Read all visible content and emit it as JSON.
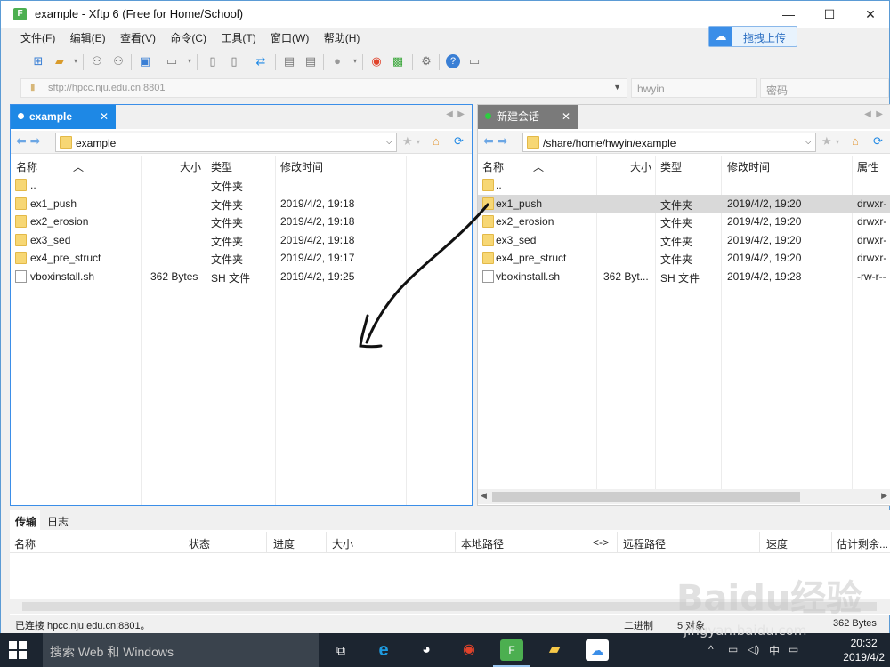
{
  "window": {
    "title": "example - Xftp 6 (Free for Home/School)",
    "minimize": "—",
    "maximize": "☐",
    "close": "✕"
  },
  "menu": [
    "文件(F)",
    "编辑(E)",
    "查看(V)",
    "命令(C)",
    "工具(T)",
    "窗口(W)",
    "帮助(H)"
  ],
  "upload_button": "拖拽上传",
  "address": {
    "url_placeholder": "sftp://hpcc.nju.edu.cn:8801",
    "user_placeholder": "hwyin",
    "password_placeholder": "密码"
  },
  "left_pane": {
    "tab_label": "example",
    "path": "example",
    "columns": [
      "名称",
      "大小",
      "类型",
      "修改时间"
    ],
    "rows": [
      {
        "name": "..",
        "size": "",
        "type": "文件夹",
        "modified": "",
        "kind": "folder"
      },
      {
        "name": "ex1_push",
        "size": "",
        "type": "文件夹",
        "modified": "2019/4/2, 19:18",
        "kind": "folder"
      },
      {
        "name": "ex2_erosion",
        "size": "",
        "type": "文件夹",
        "modified": "2019/4/2, 19:18",
        "kind": "folder"
      },
      {
        "name": "ex3_sed",
        "size": "",
        "type": "文件夹",
        "modified": "2019/4/2, 19:18",
        "kind": "folder"
      },
      {
        "name": "ex4_pre_struct",
        "size": "",
        "type": "文件夹",
        "modified": "2019/4/2, 19:17",
        "kind": "folder"
      },
      {
        "name": "vboxinstall.sh",
        "size": "362 Bytes",
        "type": "SH 文件",
        "modified": "2019/4/2, 19:25",
        "kind": "file"
      }
    ]
  },
  "right_pane": {
    "tab_label": "新建会话",
    "path": "/share/home/hwyin/example",
    "columns": [
      "名称",
      "大小",
      "类型",
      "修改时间",
      "属性"
    ],
    "rows": [
      {
        "name": "..",
        "size": "",
        "type": "",
        "modified": "",
        "attr": "",
        "kind": "folder"
      },
      {
        "name": "ex1_push",
        "size": "",
        "type": "文件夹",
        "modified": "2019/4/2, 19:20",
        "attr": "drwxr-",
        "kind": "folder",
        "selected": true
      },
      {
        "name": "ex2_erosion",
        "size": "",
        "type": "文件夹",
        "modified": "2019/4/2, 19:20",
        "attr": "drwxr-",
        "kind": "folder"
      },
      {
        "name": "ex3_sed",
        "size": "",
        "type": "文件夹",
        "modified": "2019/4/2, 19:20",
        "attr": "drwxr-",
        "kind": "folder"
      },
      {
        "name": "ex4_pre_struct",
        "size": "",
        "type": "文件夹",
        "modified": "2019/4/2, 19:20",
        "attr": "drwxr-",
        "kind": "folder"
      },
      {
        "name": "vboxinstall.sh",
        "size": "362 Byt...",
        "type": "SH 文件",
        "modified": "2019/4/2, 19:28",
        "attr": "-rw-r--",
        "kind": "file"
      }
    ]
  },
  "transfer": {
    "tabs": [
      "传输",
      "日志"
    ],
    "columns": [
      "名称",
      "状态",
      "进度",
      "大小",
      "本地路径",
      "<->",
      "远程路径",
      "速度",
      "估计剩余..."
    ]
  },
  "status_bar": {
    "connection": "已连接 hpcc.nju.edu.cn:8801。",
    "mode": "二进制",
    "objects": "5 对象",
    "size": "362 Bytes"
  },
  "taskbar": {
    "search_placeholder": "搜索 Web 和 Windows",
    "time": "20:32",
    "date": "2019/4/2",
    "ime": "中"
  },
  "watermark": {
    "brand": "Baidu经验",
    "site": "jingyan.baidu.com"
  },
  "colors": {
    "accent": "#1e88e5",
    "selected_row": "#d9d9d9",
    "folder": "#f7d774",
    "taskbar": "#1c2530"
  }
}
